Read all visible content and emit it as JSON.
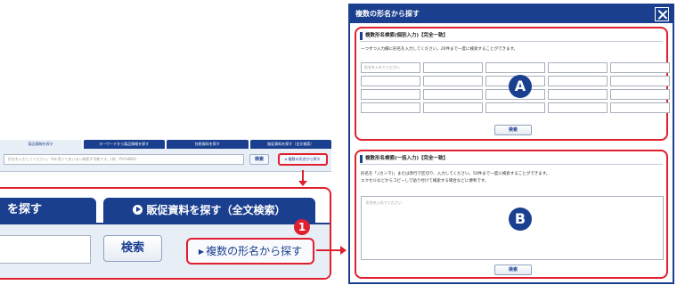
{
  "strip": {
    "tabs": [
      "製品情報を探す",
      "キーワードから製品情報を探す",
      "技術資料を探す",
      "販促資料を探す（全文検索）"
    ],
    "input_placeholder": "形名を入力してください。%を用いてあいまい検索が可能です。(例：P%%BB0)",
    "search_label": "検索",
    "multi_label": "▸ 複数の形名から探す"
  },
  "zoom": {
    "tab1_label": "を探す",
    "tab2_label": "販促資料を探す（全文検索）",
    "search_label": "検索",
    "multi_label": "複数の形名から探す",
    "pointer_icon": "▶"
  },
  "callout": {
    "badge1": "1"
  },
  "dialog": {
    "title": "複数の形名から探す",
    "section_a": {
      "title": "複数形名検索(個別入力)【完全一致】",
      "desc": "一つずつ入力欄に形名を入力してください。20件まで一度に検索することができます。",
      "first_placeholder": "形名を入れてください",
      "search_label": "検索",
      "badge": "A"
    },
    "section_b": {
      "title": "複数形名検索(一括入力)【完全一致】",
      "desc_line1": "形名を「,(カンマ)」または改行で区切り、入力してください。50件まで一度に検索することができます。",
      "desc_line2": "エクセルなどからコピーして貼り付けて検索する場合などに便利です。",
      "textarea_placeholder": "形名を入れてください",
      "search_label": "検索",
      "badge": "B"
    }
  },
  "colors": {
    "navy": "#1b3f8f",
    "highlight_red": "#e0202e",
    "panel_bg": "#e8eef6"
  }
}
